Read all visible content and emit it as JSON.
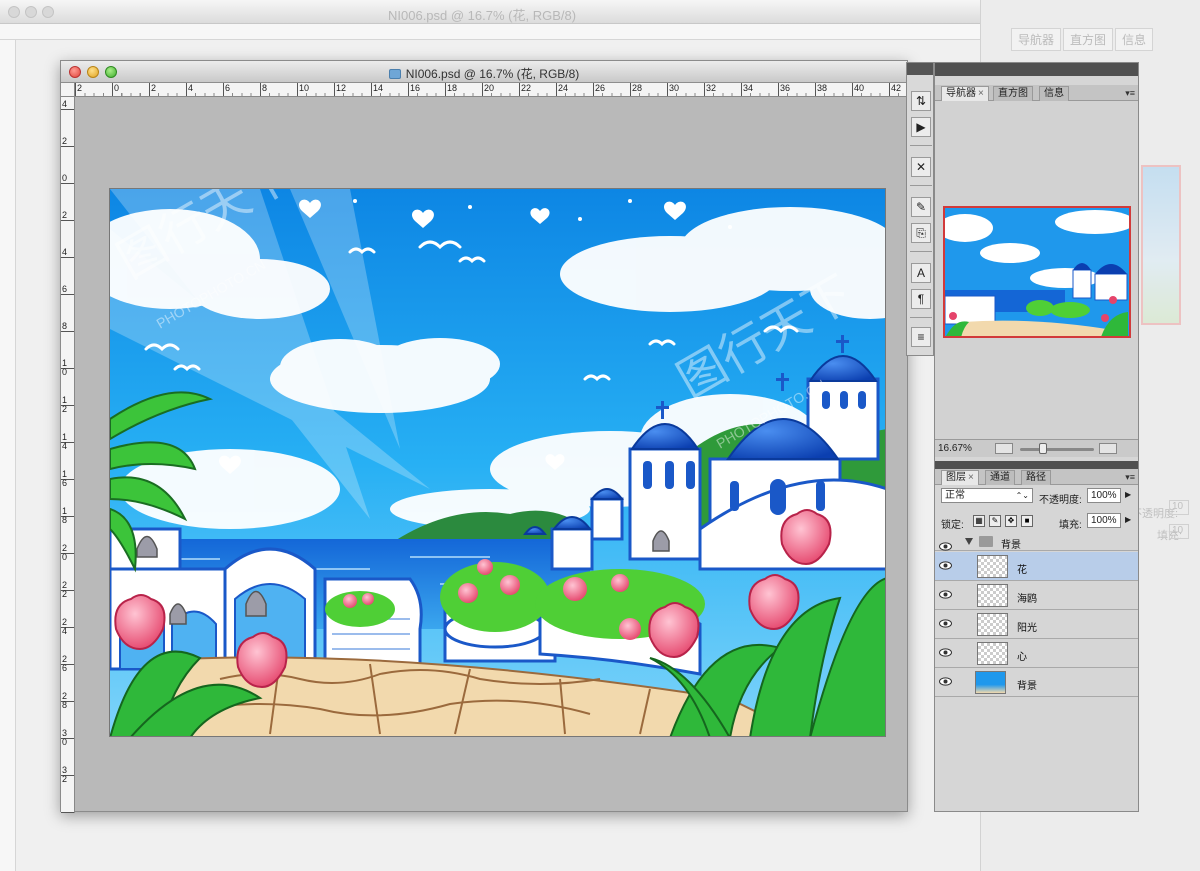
{
  "background_window": {
    "title": "NI006.psd @ 16.7% (花, RGB/8)",
    "panel_tabs": [
      "导航器",
      "直方图",
      "信息"
    ],
    "labels": [
      "不透明度:",
      "填充:"
    ],
    "values": [
      "10",
      "10"
    ]
  },
  "window": {
    "title": "NI006.psd @ 16.7% (花, RGB/8)",
    "ruler_h": [
      "2",
      "0",
      "2",
      "4",
      "6",
      "8",
      "10",
      "12",
      "14",
      "16",
      "18",
      "20",
      "22",
      "24",
      "26",
      "28",
      "30",
      "32",
      "34",
      "36",
      "38",
      "40",
      "42",
      "4"
    ],
    "ruler_v": [
      "4",
      "2",
      "0",
      "2",
      "4",
      "6",
      "8",
      "10",
      "12",
      "14",
      "16",
      "18",
      "20",
      "22",
      "24",
      "26",
      "28",
      "30",
      "32"
    ]
  },
  "tools": [
    "tool-arrange-icon",
    "tool-play-icon",
    "tool-crossed-tools-icon",
    "tool-brush-icon",
    "tool-clone-icon",
    "tool-text-icon",
    "tool-paragraph-icon",
    "tool-notes-icon"
  ],
  "navigator": {
    "tabs": [
      "导航器",
      "直方图",
      "信息"
    ],
    "zoom": "16.67%"
  },
  "layers_panel": {
    "tabs": [
      "图层",
      "通道",
      "路径"
    ],
    "blend_mode": "正常",
    "opacity_label": "不透明度:",
    "opacity_value": "100%",
    "lock_label": "锁定:",
    "fill_label": "填充:",
    "fill_value": "100%",
    "group_name": "背景",
    "layers": [
      {
        "name": "花",
        "selected": true
      },
      {
        "name": "海鸥",
        "selected": false
      },
      {
        "name": "阳光",
        "selected": false
      },
      {
        "name": "心",
        "selected": false
      },
      {
        "name": "背景",
        "selected": false
      }
    ]
  },
  "watermark": {
    "brand": "图行天下",
    "url": "PHOTOPHOTO.CN"
  },
  "colors": {
    "sky": "#1fa3ef",
    "accent_selection": "#b8cde9",
    "navigator_frame": "#d23a3a"
  }
}
